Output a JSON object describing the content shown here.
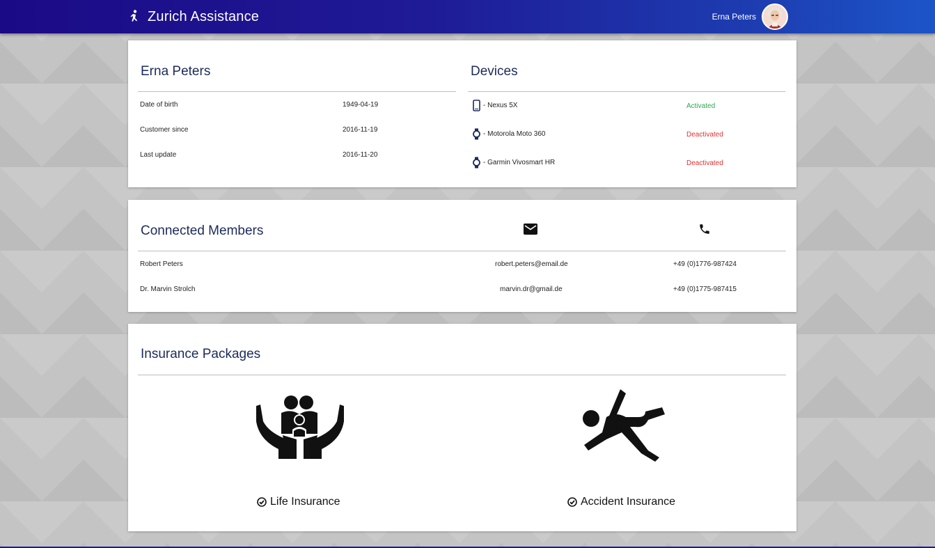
{
  "app": {
    "title": "Zurich Assistance"
  },
  "user": {
    "name": "Erna Peters"
  },
  "profile": {
    "heading": "Erna Peters",
    "rows": [
      {
        "label": "Date of birth",
        "value": "1949-04-19"
      },
      {
        "label": "Customer since",
        "value": "2016-11-19"
      },
      {
        "label": "Last update",
        "value": "2016-11-20"
      }
    ]
  },
  "devices": {
    "heading": "Devices",
    "items": [
      {
        "name": "- Nexus 5X",
        "icon": "smartphone-icon",
        "status": "Activated"
      },
      {
        "name": "- Motorola Moto 360",
        "icon": "watch-icon",
        "status": "Deactivated"
      },
      {
        "name": "- Garmin Vivosmart HR",
        "icon": "watch-icon",
        "status": "Deactivated"
      }
    ]
  },
  "members": {
    "heading": "Connected Members",
    "email_icon": "email-icon",
    "phone_icon": "phone-icon",
    "rows": [
      {
        "name": "Robert Peters",
        "email": "robert.peters@email.de",
        "phone": "+49 (0)1776-987424"
      },
      {
        "name": "Dr. Marvin Strolch",
        "email": "marvin.dr@gmail.de",
        "phone": "+49 (0)1775-987415"
      }
    ]
  },
  "insurance": {
    "heading": "Insurance Packages",
    "packages": [
      {
        "label": "Life Insurance",
        "icon": "family-hands-icon"
      },
      {
        "label": "Accident Insurance",
        "icon": "falling-person-icon"
      }
    ]
  },
  "colors": {
    "header_start": "#1b0a86",
    "header_end": "#1c55c8",
    "heading_text": "#1c2a5c",
    "activated": "#2ea84a",
    "deactivated": "#e03030"
  }
}
